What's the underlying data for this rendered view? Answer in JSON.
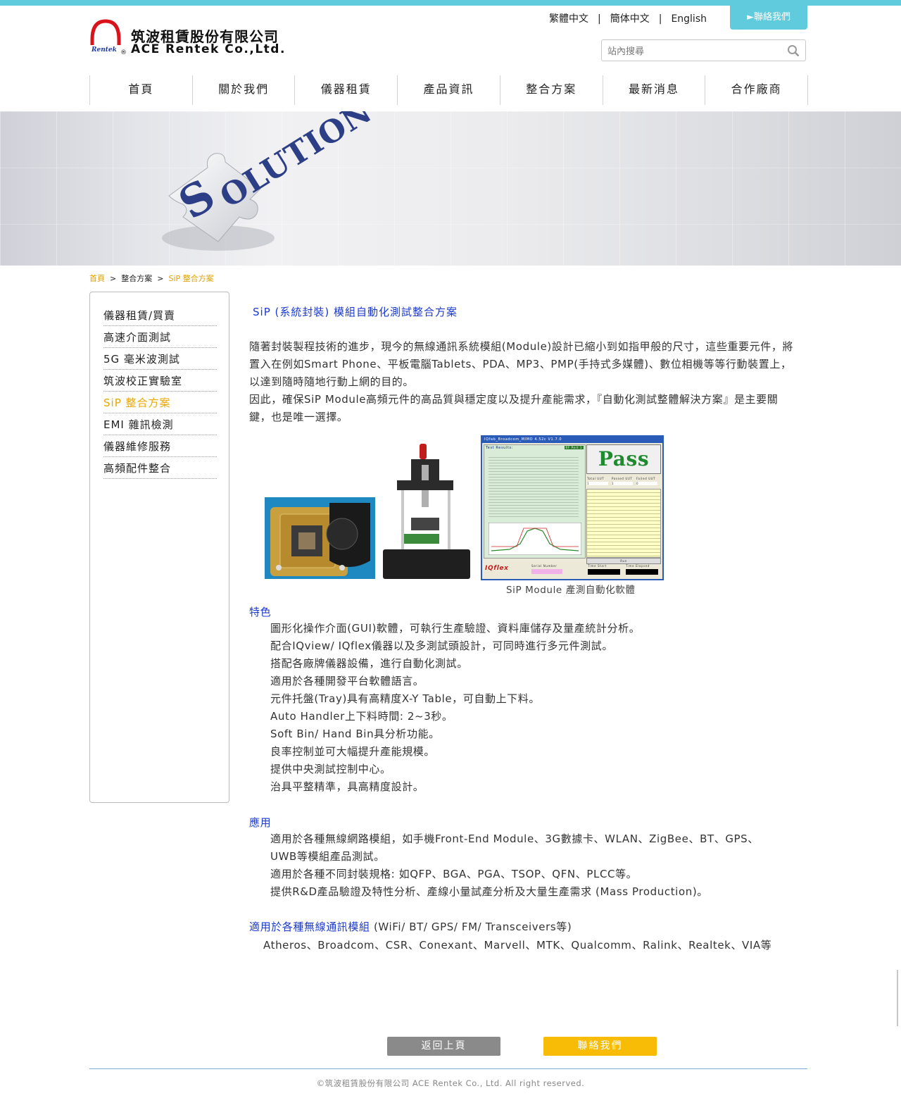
{
  "header": {
    "logo_zh": "筑波租賃股份有限公司",
    "logo_en": "ACE Rentek Co.,Ltd.",
    "logo_badge": "Rentek",
    "languages": [
      "繁體中文",
      "簡体中文",
      "English"
    ],
    "language_separator": "|",
    "contact_label": "►聯絡我們",
    "search_placeholder": "站內搜尋"
  },
  "nav": [
    "首頁",
    "關於我們",
    "儀器租賃",
    "產品資訊",
    "整合方案",
    "最新消息",
    "合作廠商"
  ],
  "banner": {
    "word": "SOLUTION"
  },
  "breadcrumb": {
    "home": "首頁",
    "sep": ">",
    "parent": "整合方案",
    "current": "SiP 整合方案"
  },
  "sidebar": {
    "items": [
      "儀器租賃/買賣",
      "高速介面測試",
      "5G 毫米波測試",
      "筑波校正實驗室",
      "SiP 整合方案",
      "EMI 雜訊檢測",
      "儀器維修服務",
      "高頻配件整合"
    ],
    "active_index": 4
  },
  "main": {
    "title": "SiP (系統封裝) 模組自動化測試整合方案",
    "intro_1": "隨著封裝製程技術的進步，現今的無線通訊系統模組(Module)設計已縮小到如指甲般的尺寸，這些重要元件，將置入在例如Smart Phone、平板電腦Tablets、PDA、MP3、PMP(手持式多媒體)、數位相機等等行動裝置上，以達到隨時隨地行動上網的目的。",
    "intro_2": "因此，確保SiP Module高頻元件的高品質與穩定度以及提升產能需求，『自動化測試整體解決方案』是主要關鍵，也是唯一選擇。",
    "figure_caption": "SiP Module 產測自動化軟體",
    "software": {
      "window_title": "IQfab_Broadcom_MIMO 4.52c V1.7.0",
      "panel_title": "Test Results:",
      "tab": "RF Port 1",
      "pass_label": "Pass",
      "cols": [
        "Total UUT",
        "Passed UUT",
        "Failed UUT"
      ],
      "counts": [
        "1",
        "1",
        "0"
      ],
      "brand": "IQflex",
      "serial_label": "Serial Number",
      "time_start_label": "Time Start",
      "time_elapsed_label": "Time Elapsed",
      "run_label": "Run"
    },
    "features_title": "特色",
    "features": [
      "圖形化操作介面(GUI)軟體，可執行生產驗證、資料庫儲存及量產統計分析。",
      "配合IQview/ IQflex儀器以及多測試頭設計，可同時進行多元件測試。",
      "搭配各廠牌儀器設備，進行自動化測試。",
      "適用於各種開發平台軟體語言。",
      "元件托盤(Tray)具有高精度X-Y Table，可自動上下料。",
      "Auto Handler上下料時間: 2~3秒。",
      "Soft Bin/ Hand Bin具分析功能。",
      "良率控制並可大幅提升產能規模。",
      "提供中央測試控制中心。",
      "治具平整精準，具高精度設計。"
    ],
    "apps_title": "應用",
    "apps": [
      "適用於各種無線網路模組，如手機Front-End Module、3G數據卡、WLAN、ZigBee、BT、GPS、",
      "UWB等模組產品測試。",
      "適用於各種不同封裝規格: 如QFP、BGA、PGA、TSOP、QFN、PLCC等。",
      "提供R&D產品驗證及特性分析、產線小量試產分析及大量生產需求 (Mass Production)。"
    ],
    "modules_title": "適用於各種無線通訊模組",
    "modules_suffix": " (WiFi/ BT/ GPS/ FM/ Transceivers等)",
    "vendors": "Atheros、Broadcom、CSR、Conexant、Marvell、MTK、Qualcomm、Ralink、Realtek、VIA等"
  },
  "buttons": {
    "back": "返回上頁",
    "contact": "聯絡我們"
  },
  "footer": "©筑波租賃股份有限公司 ACE Rentek Co., Ltd. All right reserved.",
  "colors": {
    "accent": "#5fcbdc",
    "title_blue": "#1a3ad0",
    "active_gold": "#e8a600",
    "contact_btn": "#f8bb06"
  }
}
